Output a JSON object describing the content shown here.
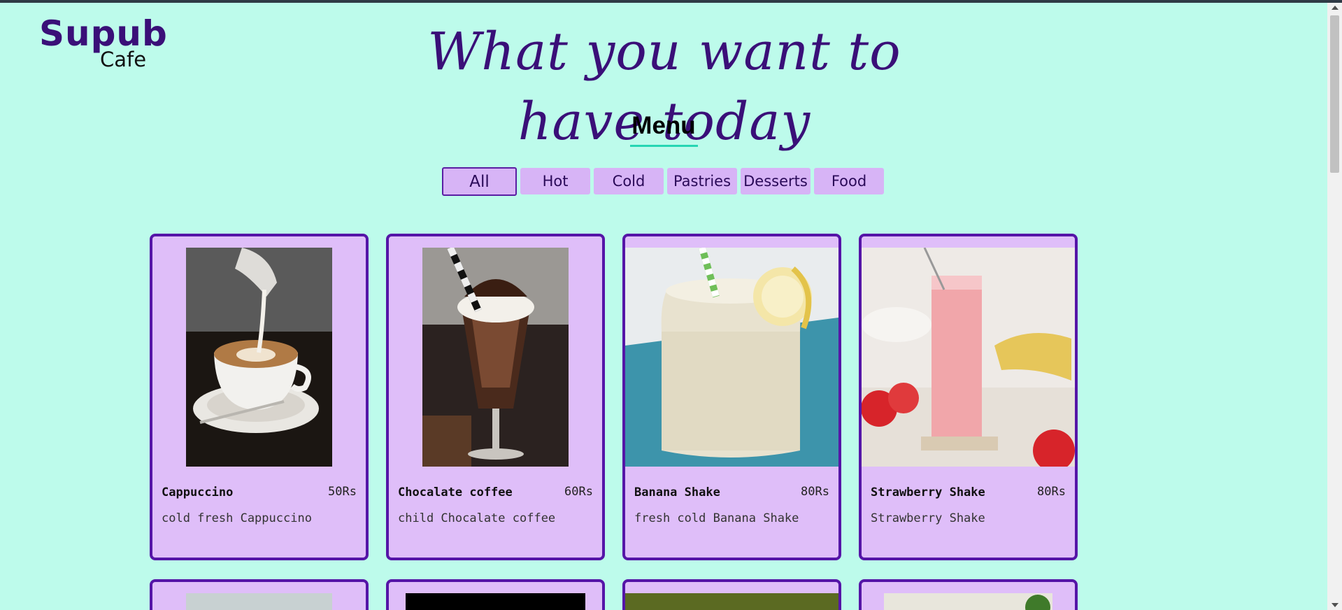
{
  "brand": {
    "name": "Supub",
    "sub": "Cafe"
  },
  "headline": "What you want to have today",
  "menu": {
    "title": "Menu",
    "filters": [
      "All",
      "Hot",
      "Cold",
      "Pastries",
      "Desserts",
      "Food"
    ],
    "active_filter": "All"
  },
  "items": [
    {
      "name": "Cappuccino",
      "price": "50Rs",
      "desc": "cold fresh Cappuccino"
    },
    {
      "name": "Chocalate coffee",
      "price": "60Rs",
      "desc": "child Chocalate coffee"
    },
    {
      "name": "Banana Shake",
      "price": "80Rs",
      "desc": "fresh cold Banana Shake"
    },
    {
      "name": "Strawberry Shake",
      "price": "80Rs",
      "desc": "Strawberry Shake"
    }
  ],
  "colors": {
    "background": "#bdfbeb",
    "accent": "#3a0f78",
    "card_bg": "#dfbef9",
    "card_border": "#5515a7",
    "button_bg": "#d7b4f6",
    "underline": "#26d6b3"
  }
}
